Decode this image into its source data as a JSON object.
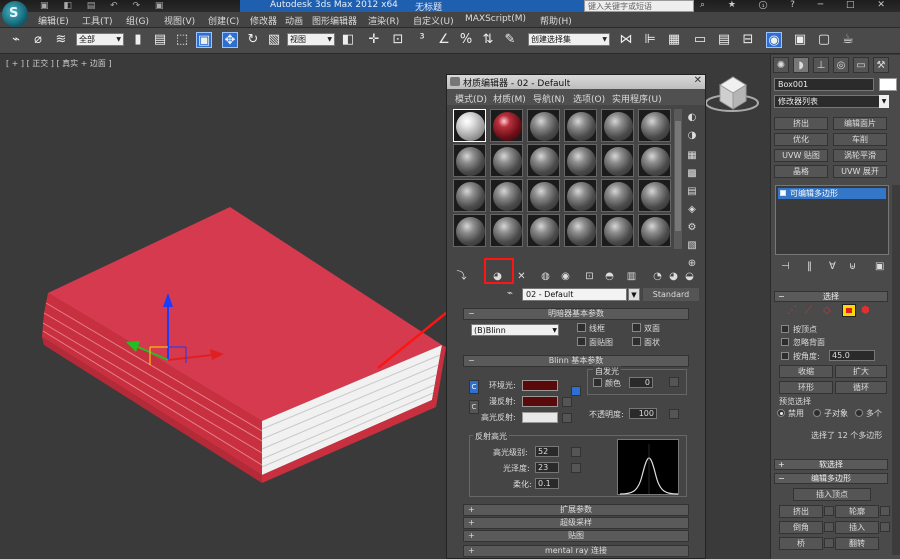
{
  "titlebar": {
    "app": "Autodesk 3ds Max  2012 x64",
    "doc": "无标题",
    "search_placeholder": "键入关键字或短语"
  },
  "menubar": [
    "编辑(E)",
    "工具(T)",
    "组(G)",
    "视图(V)",
    "创建(C)",
    "修改器",
    "动画",
    "图形编辑器",
    "渲染(R)",
    "自定义(U)",
    "MAXScript(M)",
    "帮助(H)"
  ],
  "toolbar": {
    "selection_filter": "全部",
    "ref_coord": "视图",
    "named_selection": "创建选择集"
  },
  "viewport": {
    "label": "[ + ] [ 正交 ] [ 真实 + 边面 ]"
  },
  "material_editor": {
    "title": "材质编辑器 - 02 - Default",
    "menu": [
      "模式(D)",
      "材质(M)",
      "导航(N)",
      "选项(O)",
      "实用程序(U)"
    ],
    "material_name": "02 - Default",
    "material_type": "Standard",
    "shader_basic": {
      "title": "明暗器基本参数",
      "shader": "(B)Blinn",
      "wire": "线框",
      "two_sided": "双面",
      "face_map": "面贴图",
      "faceted": "面状"
    },
    "blinn_basic": {
      "title": "Blinn 基本参数",
      "ambient": "环境光:",
      "diffuse": "漫反射:",
      "specular": "高光反射:",
      "self_illum": "自发光",
      "color": "颜色",
      "self_illum_value": "0",
      "opacity": "不透明度:",
      "opacity_value": "100",
      "ambient_color": "#5a0a0a",
      "diffuse_color": "#5a0a0a",
      "specular_color": "#e8e8e8",
      "locks": [
        "C",
        "C"
      ]
    },
    "specular_highlights": {
      "title": "反射高光",
      "level": "高光级别:",
      "level_value": "52",
      "gloss": "光泽度:",
      "gloss_value": "23",
      "soften": "柔化:",
      "soften_value": "0.1"
    },
    "rollouts": [
      "扩展参数",
      "超级采样",
      "贴图",
      "mental ray 连接"
    ]
  },
  "command_panel": {
    "object_name": "Box001",
    "modifier_list": "修改器列表",
    "buttons": [
      [
        "挤出",
        "编辑面片"
      ],
      [
        "优化",
        "车削"
      ],
      [
        "UVW 贴图",
        "涡轮平滑"
      ],
      [
        "晶格",
        "UVW 展开"
      ]
    ],
    "stack_item": "可编辑多边形",
    "selection": {
      "title": "选择",
      "by_vertex": "按顶点",
      "ignore_backface": "忽略背面",
      "by_angle": "按角度:",
      "angle_value": "45.0",
      "shrink": "收缩",
      "grow": "扩大",
      "ring": "环形",
      "loop": "循环",
      "preview": "预览选择",
      "disabled": "禁用",
      "subobject": "子对象",
      "multiple": "多个",
      "status": "选择了 12 个多边形"
    },
    "rollouts": [
      "软选择",
      "编辑多边形"
    ],
    "edit_poly": {
      "insert_vertex": "插入顶点",
      "extrude": "挤出",
      "outline": "轮廓",
      "bevel": "倒角",
      "inset": "插入",
      "bridge": "桥",
      "flip": "翻转"
    }
  },
  "colors": {
    "book_cover": "#d63a4e",
    "annotation": "#ff1414",
    "accent": "#3476c7"
  }
}
